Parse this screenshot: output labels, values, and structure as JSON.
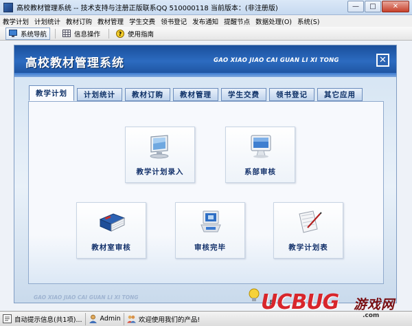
{
  "window": {
    "title": "高校教材管理系统 -- 技术支持与注册正版联系QQ 510000118   当前版本：(非注册版)",
    "min_glyph": "—",
    "max_glyph": "□",
    "close_glyph": "✕"
  },
  "menu": {
    "items": [
      "教学计划",
      "计划统计",
      "教材订购",
      "教材管理",
      "学生交费",
      "领书登记",
      "发布通知",
      "提醒节点",
      "数据处理(O)",
      "系统(S)"
    ]
  },
  "toolbar": {
    "items": [
      {
        "label": "系统导航",
        "icon": "navigation-icon"
      },
      {
        "label": "信息操作",
        "icon": "grid-icon"
      },
      {
        "label": "使用指南",
        "icon": "help-icon"
      }
    ]
  },
  "panel": {
    "title": "高校教材管理系统",
    "subtitle": "GAO XIAO JIAO CAI GUAN LI XI TONG",
    "close_glyph": "✕",
    "footer_text": "GAO XIAO JIAO CAI GUAN LI XI TONG",
    "tabs": [
      "教学计划",
      "计划统计",
      "教材订购",
      "教材管理",
      "学生交费",
      "领书登记",
      "其它应用"
    ],
    "active_tab": 0,
    "tiles": [
      {
        "label": "教学计划录入",
        "icon": "monitor-icon"
      },
      {
        "label": "系部审核",
        "icon": "imac-icon"
      },
      {
        "label": "教材室审核",
        "icon": "book-icon"
      },
      {
        "label": "审核完毕",
        "icon": "server-icon"
      },
      {
        "label": "教学计划表",
        "icon": "document-icon"
      }
    ]
  },
  "statusbar": {
    "hint": "自动提示信息(共1项)...",
    "user": "Admin",
    "welcome": "欢迎使用我们的产品!"
  },
  "watermark": {
    "brand": "UCBUG",
    "brand_cn": "游戏网",
    "url": ".com",
    "partial": "用"
  }
}
